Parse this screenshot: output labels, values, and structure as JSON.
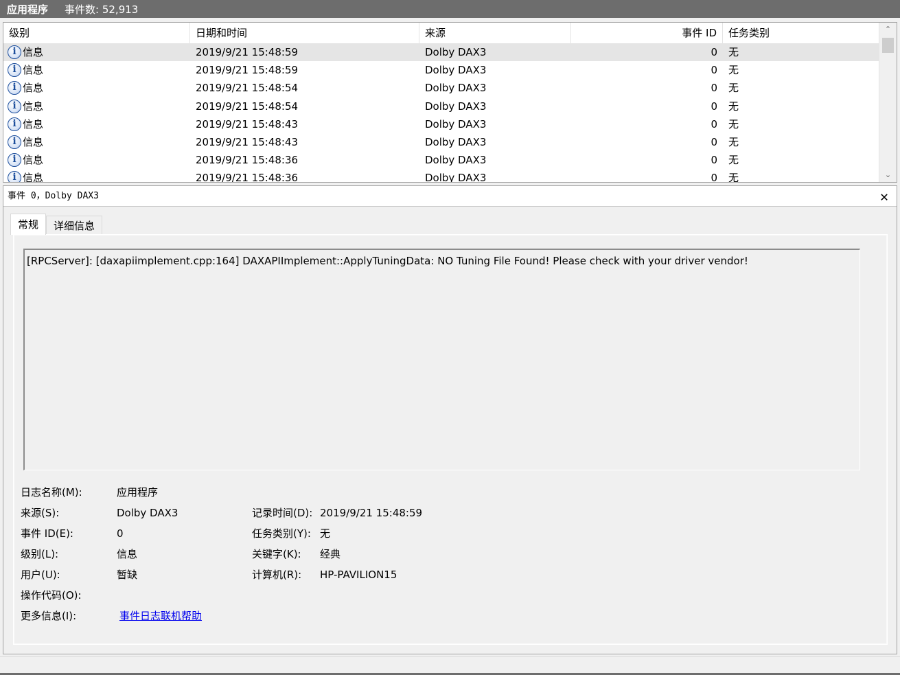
{
  "titlebar": {
    "log_name": "应用程序",
    "event_count": "事件数: 52,913"
  },
  "grid": {
    "columns": [
      "级别",
      "日期和时间",
      "来源",
      "事件 ID",
      "任务类别"
    ],
    "rows": [
      {
        "level": "信息",
        "datetime": "2019/9/21 15:48:59",
        "source": "Dolby DAX3",
        "event_id": "0",
        "task": "无",
        "selected": true
      },
      {
        "level": "信息",
        "datetime": "2019/9/21 15:48:59",
        "source": "Dolby DAX3",
        "event_id": "0",
        "task": "无"
      },
      {
        "level": "信息",
        "datetime": "2019/9/21 15:48:54",
        "source": "Dolby DAX3",
        "event_id": "0",
        "task": "无"
      },
      {
        "level": "信息",
        "datetime": "2019/9/21 15:48:54",
        "source": "Dolby DAX3",
        "event_id": "0",
        "task": "无"
      },
      {
        "level": "信息",
        "datetime": "2019/9/21 15:48:43",
        "source": "Dolby DAX3",
        "event_id": "0",
        "task": "无"
      },
      {
        "level": "信息",
        "datetime": "2019/9/21 15:48:43",
        "source": "Dolby DAX3",
        "event_id": "0",
        "task": "无"
      },
      {
        "level": "信息",
        "datetime": "2019/9/21 15:48:36",
        "source": "Dolby DAX3",
        "event_id": "0",
        "task": "无"
      },
      {
        "level": "信息",
        "datetime": "2019/9/21 15:48:36",
        "source": "Dolby DAX3",
        "event_id": "0",
        "task": "无"
      }
    ],
    "icon": "info-icon"
  },
  "detail": {
    "title": "事件 0，Dolby DAX3",
    "tabs": [
      "常规",
      "详细信息"
    ],
    "message": "[RPCServer]: [daxapiimplement.cpp:164] DAXAPIImplement::ApplyTuningData: NO Tuning File Found! Please check with your driver vendor!",
    "props": {
      "log_name_label": "日志名称(M):",
      "log_name_value": "应用程序",
      "source_label": "来源(S):",
      "source_value": "Dolby DAX3",
      "logged_label": "记录时间(D):",
      "logged_value": "2019/9/21 15:48:59",
      "event_id_label": "事件 ID(E):",
      "event_id_value": "0",
      "task_label": "任务类别(Y):",
      "task_value": "无",
      "level_label": "级别(L):",
      "level_value": "信息",
      "keywords_label": "关键字(K):",
      "keywords_value": "经典",
      "user_label": "用户(U):",
      "user_value": "暂缺",
      "computer_label": "计算机(R):",
      "computer_value": "HP-PAVILION15",
      "opcode_label": "操作代码(O):",
      "opcode_value": "",
      "more_info_label": "更多信息(I):",
      "more_info_link": "事件日志联机帮助"
    }
  }
}
